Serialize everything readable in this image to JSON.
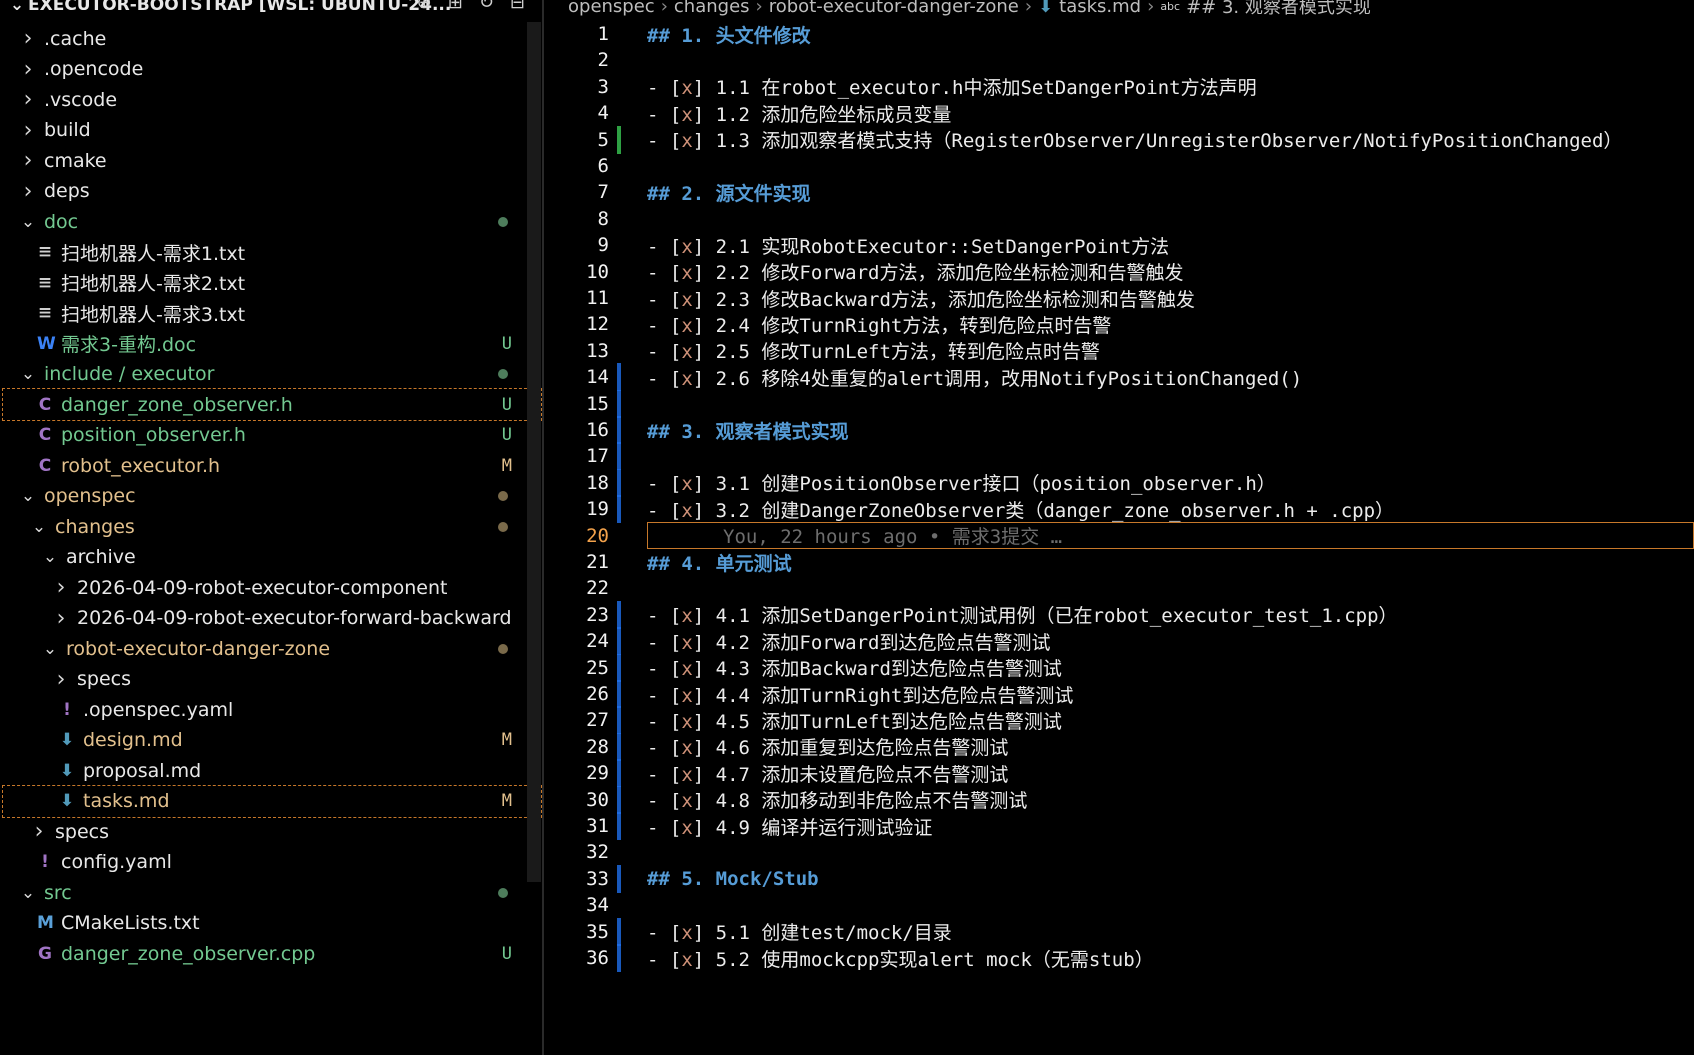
{
  "explorer": {
    "title": "EXECUTOR-BOOTSTRAP [WSL: UBUNTU-24...",
    "actions": [
      "new-file-icon",
      "new-folder-icon",
      "refresh-icon",
      "collapse-icon"
    ],
    "items": [
      {
        "label": ".cache",
        "kind": "folder",
        "expanded": false,
        "depth": 0
      },
      {
        "label": ".opencode",
        "kind": "folder",
        "expanded": false,
        "depth": 0
      },
      {
        "label": ".vscode",
        "kind": "folder",
        "expanded": false,
        "depth": 0
      },
      {
        "label": "build",
        "kind": "folder",
        "expanded": false,
        "depth": 0
      },
      {
        "label": "cmake",
        "kind": "folder",
        "expanded": false,
        "depth": 0
      },
      {
        "label": "deps",
        "kind": "folder",
        "expanded": false,
        "depth": 0
      },
      {
        "label": "doc",
        "kind": "folder",
        "expanded": true,
        "depth": 0,
        "status": "dot-u"
      },
      {
        "label": "扫地机器人-需求1.txt",
        "kind": "txt",
        "depth": 1
      },
      {
        "label": "扫地机器人-需求2.txt",
        "kind": "txt",
        "depth": 1
      },
      {
        "label": "扫地机器人-需求3.txt",
        "kind": "txt",
        "depth": 1
      },
      {
        "label": "需求3-重构.doc",
        "kind": "doc",
        "depth": 1,
        "status": "U"
      },
      {
        "label": "include / executor",
        "kind": "folder",
        "expanded": true,
        "depth": 0,
        "status": "dot-u"
      },
      {
        "label": "danger_zone_observer.h",
        "kind": "c",
        "depth": 1,
        "status": "U",
        "selected": true
      },
      {
        "label": "position_observer.h",
        "kind": "c",
        "depth": 1,
        "status": "U"
      },
      {
        "label": "robot_executor.h",
        "kind": "c",
        "depth": 1,
        "status": "M"
      },
      {
        "label": "openspec",
        "kind": "folder",
        "expanded": true,
        "depth": 0,
        "status": "dot-m"
      },
      {
        "label": "changes",
        "kind": "folder",
        "expanded": true,
        "depth": 1,
        "status": "dot-m"
      },
      {
        "label": "archive",
        "kind": "folder",
        "expanded": true,
        "depth": 2
      },
      {
        "label": "2026-04-09-robot-executor-component",
        "kind": "folder",
        "expanded": false,
        "depth": 3
      },
      {
        "label": "2026-04-09-robot-executor-forward-backward",
        "kind": "folder",
        "expanded": false,
        "depth": 3
      },
      {
        "label": "robot-executor-danger-zone",
        "kind": "folder",
        "expanded": true,
        "depth": 2,
        "status": "dot-m"
      },
      {
        "label": "specs",
        "kind": "folder",
        "expanded": false,
        "depth": 3
      },
      {
        "label": ".openspec.yaml",
        "kind": "yaml",
        "depth": 3
      },
      {
        "label": "design.md",
        "kind": "md",
        "depth": 3,
        "status": "M"
      },
      {
        "label": "proposal.md",
        "kind": "md",
        "depth": 3
      },
      {
        "label": "tasks.md",
        "kind": "md",
        "depth": 3,
        "status": "M",
        "selected": true
      },
      {
        "label": "specs",
        "kind": "folder",
        "expanded": false,
        "depth": 1
      },
      {
        "label": "config.yaml",
        "kind": "yaml",
        "depth": 1
      },
      {
        "label": "src",
        "kind": "folder",
        "expanded": true,
        "depth": 0,
        "status": "dot-u"
      },
      {
        "label": "CMakeLists.txt",
        "kind": "cmake",
        "depth": 1
      },
      {
        "label": "danger_zone_observer.cpp",
        "kind": "cpp",
        "depth": 1,
        "status": "U"
      }
    ]
  },
  "breadcrumb": [
    "openspec",
    "changes",
    "robot-executor-danger-zone",
    "tasks.md",
    "## 3. 观察者模式实现"
  ],
  "editor": {
    "current_line": 20,
    "blame": "You, 22 hours ago • 需求3提交 …",
    "lines": [
      {
        "n": 1,
        "text": "## 1. 头文件修改"
      },
      {
        "n": 2,
        "text": ""
      },
      {
        "n": 3,
        "text": "- [x] 1.1 在robot_executor.h中添加SetDangerPoint方法声明"
      },
      {
        "n": 4,
        "text": "- [x] 1.2 添加危险坐标成员变量"
      },
      {
        "n": 5,
        "text": "- [x] 1.3 添加观察者模式支持（RegisterObserver/UnregisterObserver/NotifyPositionChanged）",
        "mark": "mod"
      },
      {
        "n": 6,
        "text": ""
      },
      {
        "n": 7,
        "text": "## 2. 源文件实现"
      },
      {
        "n": 8,
        "text": ""
      },
      {
        "n": 9,
        "text": "- [x] 2.1 实现RobotExecutor::SetDangerPoint方法"
      },
      {
        "n": 10,
        "text": "- [x] 2.2 修改Forward方法，添加危险坐标检测和告警触发"
      },
      {
        "n": 11,
        "text": "- [x] 2.3 修改Backward方法，添加危险坐标检测和告警触发"
      },
      {
        "n": 12,
        "text": "- [x] 2.4 修改TurnRight方法，转到危险点时告警"
      },
      {
        "n": 13,
        "text": "- [x] 2.5 修改TurnLeft方法，转到危险点时告警"
      },
      {
        "n": 14,
        "text": "- [x] 2.6 移除4处重复的alert调用，改用NotifyPositionChanged()",
        "mark": "blue"
      },
      {
        "n": 15,
        "text": "",
        "mark": "blue"
      },
      {
        "n": 16,
        "text": "## 3. 观察者模式实现",
        "mark": "blue"
      },
      {
        "n": 17,
        "text": "",
        "mark": "blue"
      },
      {
        "n": 18,
        "text": "- [x] 3.1 创建PositionObserver接口（position_observer.h）",
        "mark": "blue"
      },
      {
        "n": 19,
        "text": "- [x] 3.2 创建DangerZoneObserver类（danger_zone_observer.h + .cpp）",
        "mark": "blue"
      },
      {
        "n": 20,
        "text": ""
      },
      {
        "n": 21,
        "text": "## 4. 单元测试"
      },
      {
        "n": 22,
        "text": ""
      },
      {
        "n": 23,
        "text": "- [x] 4.1 添加SetDangerPoint测试用例（已在robot_executor_test_1.cpp）",
        "mark": "blue"
      },
      {
        "n": 24,
        "text": "- [x] 4.2 添加Forward到达危险点告警测试",
        "mark": "blue"
      },
      {
        "n": 25,
        "text": "- [x] 4.3 添加Backward到达危险点告警测试",
        "mark": "blue"
      },
      {
        "n": 26,
        "text": "- [x] 4.4 添加TurnRight到达危险点告警测试",
        "mark": "blue"
      },
      {
        "n": 27,
        "text": "- [x] 4.5 添加TurnLeft到达危险点告警测试",
        "mark": "blue"
      },
      {
        "n": 28,
        "text": "- [x] 4.6 添加重复到达危险点告警测试",
        "mark": "blue"
      },
      {
        "n": 29,
        "text": "- [x] 4.7 添加未设置危险点不告警测试",
        "mark": "blue"
      },
      {
        "n": 30,
        "text": "- [x] 4.8 添加移动到非危险点不告警测试",
        "mark": "blue"
      },
      {
        "n": 31,
        "text": "- [x] 4.9 编译并运行测试验证",
        "mark": "blue"
      },
      {
        "n": 32,
        "text": ""
      },
      {
        "n": 33,
        "text": "## 5. Mock/Stub",
        "mark": "blue"
      },
      {
        "n": 34,
        "text": ""
      },
      {
        "n": 35,
        "text": "- [x] 5.1 创建test/mock/目录",
        "mark": "blue"
      },
      {
        "n": 36,
        "text": "- [x] 5.2 使用mockcpp实现alert mock（无需stub）",
        "mark": "blue"
      }
    ]
  },
  "colors": {
    "git_untracked": "#73c991",
    "git_modified": "#e2c08d",
    "heading": "#569cd6",
    "checkbox": "#ce9178",
    "current_line_border": "#c7782a"
  }
}
